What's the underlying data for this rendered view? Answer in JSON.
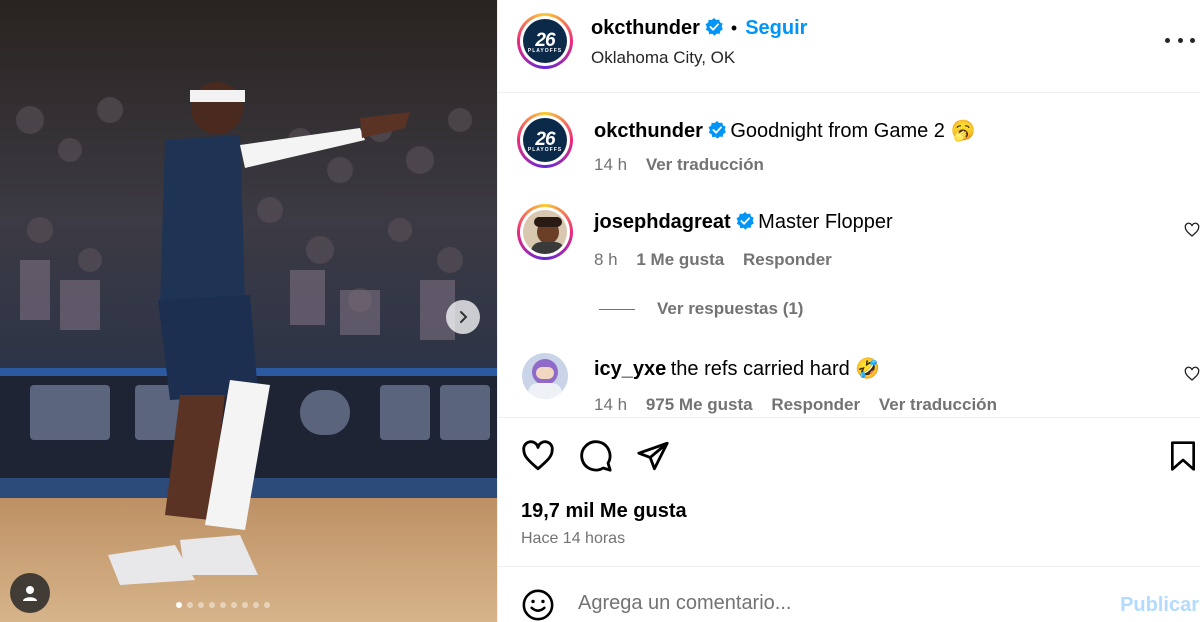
{
  "post": {
    "username": "okcthunder",
    "follow_label": "Seguir",
    "separator": "•",
    "location": "Oklahoma City, OK",
    "avatar_text": "26",
    "avatar_subtext": "PLAYOFFS"
  },
  "caption": {
    "username": "okcthunder",
    "text": "Goodnight from Game 2 🥱",
    "time": "14 h",
    "translate": "Ver traducción"
  },
  "comments": [
    {
      "username": "josephdagreat",
      "text": "Master Flopper",
      "time": "8 h",
      "likes": "1 Me gusta",
      "reply": "Responder"
    },
    {
      "username": "icy_yxe",
      "text": "the refs carried hard 🤣",
      "time": "14 h",
      "likes": "975 Me gusta",
      "reply": "Responder",
      "translate": "Ver traducción"
    }
  ],
  "view_replies": "Ver respuestas (1)",
  "likes_total": "19,7 mil Me gusta",
  "posted_ago": "Hace 14 horas",
  "comment_box": {
    "placeholder": "Agrega un comentario...",
    "publish_label": "Publicar"
  },
  "colors": {
    "accent": "#0095f6",
    "publish_disabled": "#b3dbff",
    "muted": "#737373",
    "verified": "#0095f6"
  },
  "icons": [
    "verified-badge-icon",
    "more-options-icon",
    "heart-icon",
    "comment-icon",
    "share-icon",
    "bookmark-icon",
    "emoji-icon",
    "next-arrow-icon",
    "user-tag-icon"
  ]
}
